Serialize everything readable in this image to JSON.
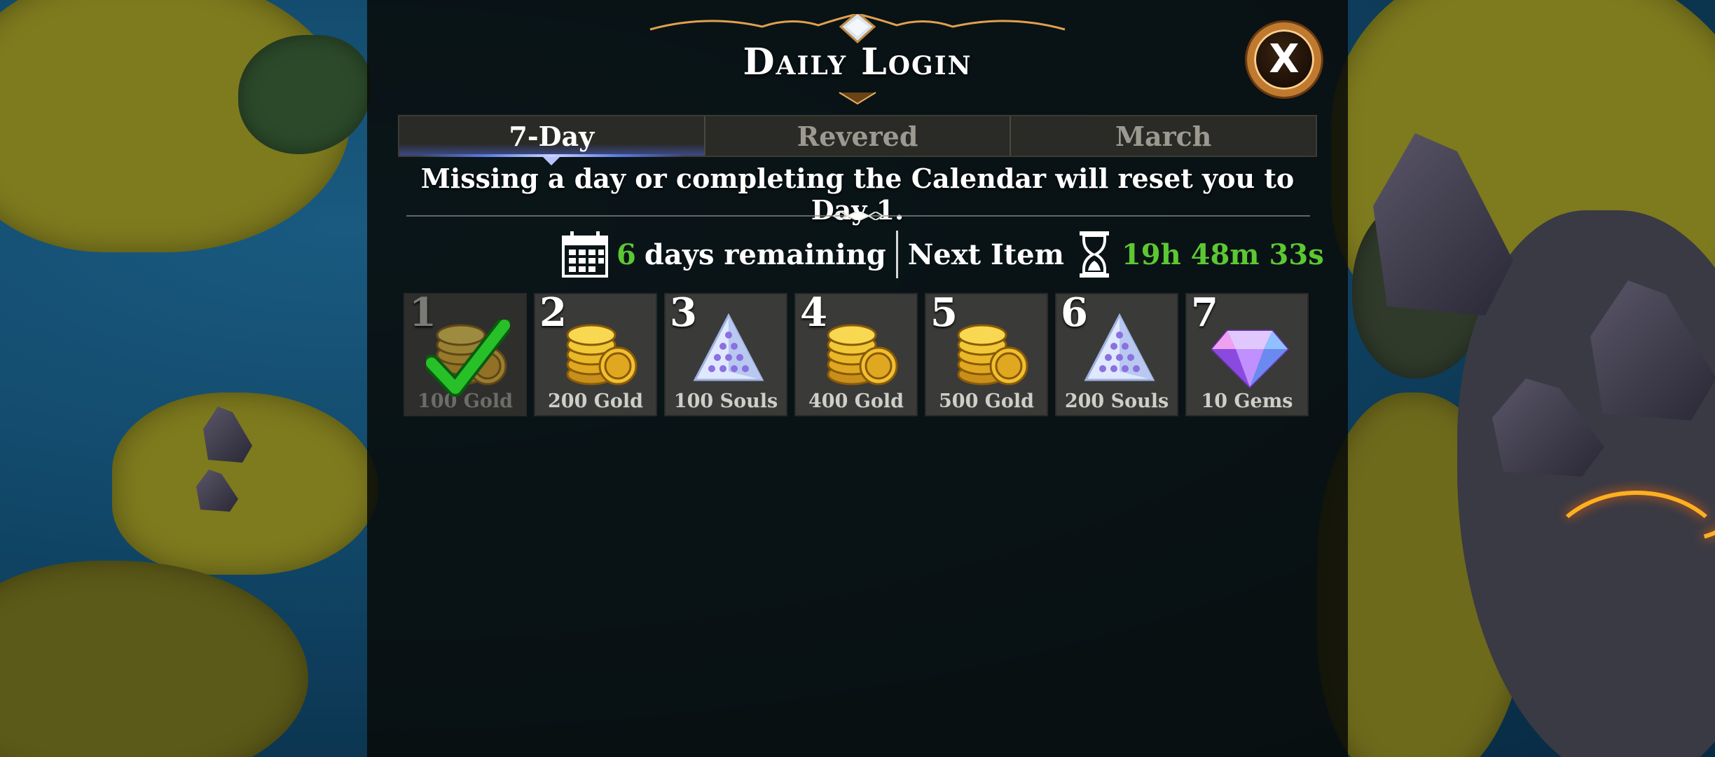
{
  "header": {
    "title": "Daily Login",
    "close_label": "X"
  },
  "tabs": [
    {
      "label": "7-Day",
      "active": true
    },
    {
      "label": "Revered",
      "active": false
    },
    {
      "label": "March",
      "active": false
    }
  ],
  "notice": "Missing a day or completing the Calendar will reset you to Day 1.",
  "status": {
    "days_remaining_count": "6",
    "days_remaining_text": "days remaining",
    "next_item_label": "Next Item",
    "next_item_timer": "19h 48m 33s"
  },
  "rewards": [
    {
      "day": "1",
      "label": "100 Gold",
      "icon": "gold-coins-icon",
      "claimed": true
    },
    {
      "day": "2",
      "label": "200 Gold",
      "icon": "gold-coins-icon",
      "claimed": false
    },
    {
      "day": "3",
      "label": "100 Souls",
      "icon": "souls-pyramid-icon",
      "claimed": false
    },
    {
      "day": "4",
      "label": "400 Gold",
      "icon": "gold-coins-icon",
      "claimed": false
    },
    {
      "day": "5",
      "label": "500 Gold",
      "icon": "gold-coins-icon",
      "claimed": false
    },
    {
      "day": "6",
      "label": "200 Souls",
      "icon": "souls-pyramid-icon",
      "claimed": false
    },
    {
      "day": "7",
      "label": "10 Gems",
      "icon": "gem-icon",
      "claimed": false
    }
  ],
  "colors": {
    "accent_green": "#5cc832",
    "frame_gold": "#c07a30",
    "tab_active_glow": "#5a7ae0"
  }
}
